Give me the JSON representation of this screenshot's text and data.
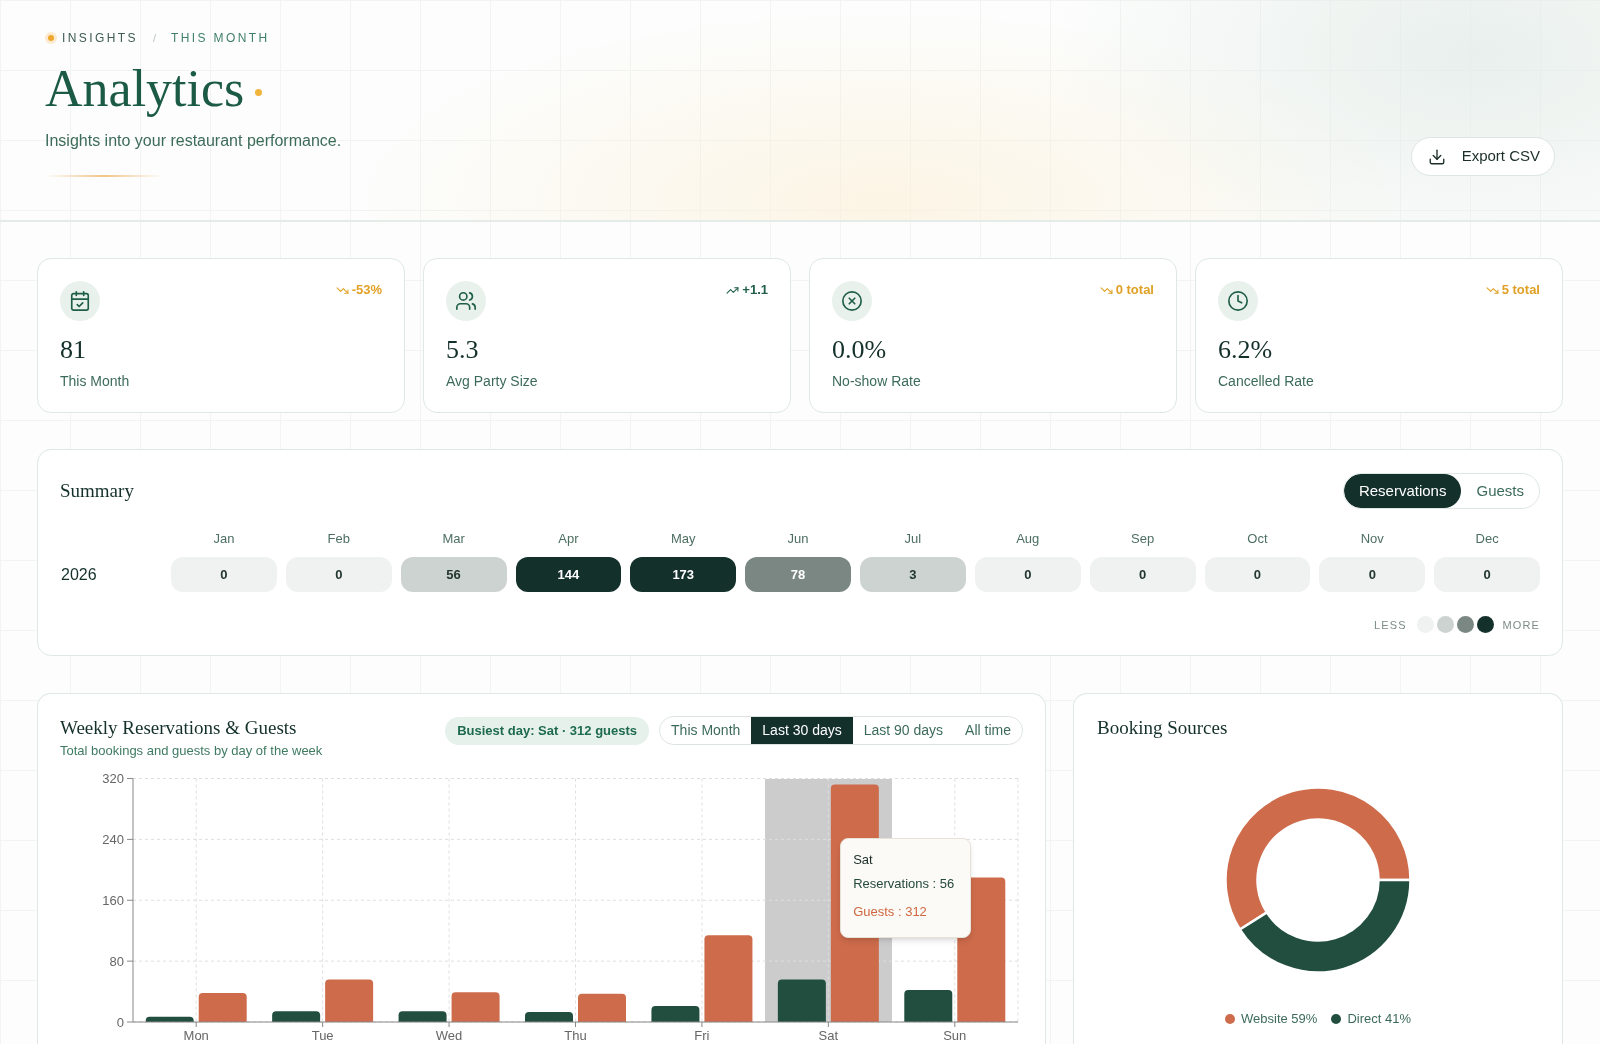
{
  "header": {
    "breadcrumb": {
      "items": [
        {
          "label": "INSIGHTS",
          "current": false
        },
        {
          "label": "THIS MONTH",
          "current": true
        }
      ],
      "separator": "/"
    },
    "title": "Analytics",
    "subtitle": "Insights into your restaurant performance.",
    "export_button": "Export CSV"
  },
  "kpis": [
    {
      "value": "81",
      "label": "This Month",
      "trend": {
        "rising": false,
        "text": "-53%"
      }
    },
    {
      "value": "5.3",
      "label": "Avg Party Size",
      "trend": {
        "rising": true,
        "text": "+1.1"
      }
    },
    {
      "value": "0.0%",
      "label": "No-show Rate",
      "trend": {
        "rising": false,
        "text": "0 total"
      }
    },
    {
      "value": "6.2%",
      "label": "Cancelled Rate",
      "trend": {
        "rising": false,
        "text": "5 total"
      }
    }
  ],
  "summary": {
    "title": "Summary",
    "toggle": [
      {
        "label": "Reservations",
        "selected": true
      },
      {
        "label": "Guests",
        "selected": false
      }
    ],
    "months": [
      "Jan",
      "Feb",
      "Mar",
      "Apr",
      "May",
      "Jun",
      "Jul",
      "Aug",
      "Sep",
      "Oct",
      "Nov",
      "Dec"
    ],
    "rows": [
      {
        "year": "2026",
        "cells": [
          {
            "value": "0",
            "color": "#eff2f0"
          },
          {
            "value": "0",
            "color": "#eff2f0"
          },
          {
            "value": "56",
            "color": "#cdd3d0"
          },
          {
            "value": "144",
            "color": "#14302a"
          },
          {
            "value": "173",
            "color": "#14302a"
          },
          {
            "value": "78",
            "color": "#7b8782"
          },
          {
            "value": "3",
            "color": "#cdd3d0"
          },
          {
            "value": "0",
            "color": "#eff2f0"
          },
          {
            "value": "0",
            "color": "#eff2f0"
          },
          {
            "value": "0",
            "color": "#eff2f0"
          },
          {
            "value": "0",
            "color": "#eff2f0"
          },
          {
            "value": "0",
            "color": "#eff2f0"
          }
        ]
      }
    ],
    "legend": {
      "less": "LESS",
      "more": "MORE",
      "swatches": [
        {
          "color": "#eff2f0"
        },
        {
          "color": "#cdd3d0"
        },
        {
          "color": "#7b8782"
        },
        {
          "color": "#14302a"
        }
      ]
    }
  },
  "weekly": {
    "title": "Weekly Reservations & Guests",
    "subtitle": "Total bookings and guests by day of the week",
    "badge": "Busiest day: Sat · 312 guests",
    "ranges": [
      {
        "label": "This Month",
        "selected": false
      },
      {
        "label": "Last 30 days",
        "selected": true
      },
      {
        "label": "Last 90 days",
        "selected": false
      },
      {
        "label": "All time",
        "selected": false
      }
    ],
    "chart_data": {
      "type": "bar",
      "categories": [
        "Mon",
        "Tue",
        "Wed",
        "Thu",
        "Fri",
        "Sat",
        "Sun"
      ],
      "series": [
        {
          "color": "#214e3f",
          "values": [
            7,
            14,
            14,
            13,
            21,
            56,
            42
          ]
        },
        {
          "color": "#cd6b4b",
          "values": [
            38,
            56,
            39,
            37,
            114,
            312,
            190
          ]
        }
      ],
      "ylim": [
        0,
        320
      ],
      "yticks": [
        0,
        80,
        160,
        240,
        320
      ],
      "grid": true
    },
    "hovered_days": [
      false,
      false,
      false,
      false,
      false,
      true,
      false
    ],
    "tooltip": {
      "title": "Sat",
      "rows": [
        {
          "text": "Reservations : 56",
          "color": "#24493b"
        },
        {
          "text": "Guests : 312",
          "color": "#cf673f"
        }
      ]
    }
  },
  "booking_sources": {
    "title": "Booking Sources",
    "chart_data": {
      "type": "donut",
      "values": [
        59,
        41
      ]
    },
    "legend": [
      {
        "label": "Website 59%",
        "color": "#cd6b4b"
      },
      {
        "label": "Direct 41%",
        "color": "#214e3f"
      }
    ]
  }
}
